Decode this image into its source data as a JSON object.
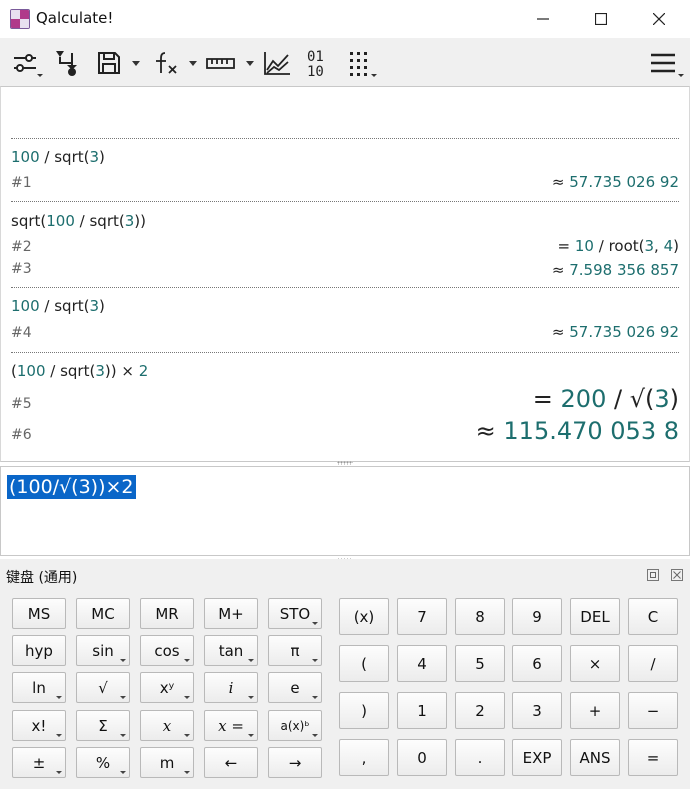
{
  "window": {
    "title": "Qalculate!"
  },
  "history": {
    "entries": [
      {
        "expression_parts": [
          [
            "100",
            "num"
          ],
          [
            " ∕ sqrt(",
            ""
          ],
          [
            "3",
            "num"
          ],
          [
            ")",
            ""
          ]
        ],
        "results": [
          {
            "ref": "#1",
            "prefix": "≈ ",
            "parts": [
              [
                "57.735 026 92",
                "num"
              ]
            ]
          }
        ]
      },
      {
        "expression_parts": [
          [
            "sqrt(",
            ""
          ],
          [
            "100",
            "num"
          ],
          [
            " ∕ sqrt(",
            ""
          ],
          [
            "3",
            "num"
          ],
          [
            "))",
            ""
          ]
        ],
        "results": [
          {
            "ref": "#2",
            "prefix": "= ",
            "parts": [
              [
                "10",
                "num"
              ],
              [
                " ∕ root(",
                ""
              ],
              [
                "3",
                "num"
              ],
              [
                ", ",
                ""
              ],
              [
                "4",
                "num"
              ],
              [
                ")",
                ""
              ]
            ]
          },
          {
            "ref": "#3",
            "prefix": "≈ ",
            "parts": [
              [
                "7.598 356 857",
                "num"
              ]
            ]
          }
        ]
      },
      {
        "expression_parts": [
          [
            "100",
            "num"
          ],
          [
            " ∕ sqrt(",
            ""
          ],
          [
            "3",
            "num"
          ],
          [
            ")",
            ""
          ]
        ],
        "results": [
          {
            "ref": "#4",
            "prefix": "≈ ",
            "parts": [
              [
                "57.735 026 92",
                "num"
              ]
            ]
          }
        ]
      },
      {
        "expression_parts": [
          [
            "(",
            ""
          ],
          [
            "100",
            "num"
          ],
          [
            " ∕ sqrt(",
            ""
          ],
          [
            "3",
            "num"
          ],
          [
            ")) × ",
            ""
          ],
          [
            "2",
            "num"
          ]
        ],
        "results": [
          {
            "ref": "#5",
            "prefix": "= ",
            "parts": [
              [
                "200",
                "num"
              ],
              [
                " ∕ √(",
                ""
              ],
              [
                "3",
                "num"
              ],
              [
                ")",
                ""
              ]
            ]
          },
          {
            "ref": "#6",
            "prefix": "≈ ",
            "parts": [
              [
                "115.470 053 8",
                "num"
              ]
            ]
          }
        ]
      }
    ]
  },
  "entry": {
    "text": "(100/√(3))×2"
  },
  "keypad": {
    "title": "键盘 (通用)",
    "left_rows": [
      [
        {
          "label": "MS",
          "drop": false
        },
        {
          "label": "MC",
          "drop": false
        },
        {
          "label": "MR",
          "drop": false
        },
        {
          "label": "M+",
          "drop": false
        },
        {
          "label": "STO",
          "drop": true
        }
      ],
      [
        {
          "label": "hyp",
          "drop": false
        },
        {
          "label": "sin",
          "drop": true
        },
        {
          "label": "cos",
          "drop": true
        },
        {
          "label": "tan",
          "drop": true
        },
        {
          "label": "π",
          "drop": true
        }
      ],
      [
        {
          "label": "ln",
          "drop": true
        },
        {
          "label": "√",
          "drop": true
        },
        {
          "label": "xʸ",
          "drop": true
        },
        {
          "label": "i",
          "drop": true,
          "italic": true
        },
        {
          "label": "e",
          "drop": true
        }
      ],
      [
        {
          "label": "x!",
          "drop": true
        },
        {
          "label": "Σ",
          "drop": true
        },
        {
          "label": "x",
          "drop": true,
          "italic": true
        },
        {
          "label": "x =",
          "drop": true,
          "italic": true
        },
        {
          "label": "a(x)ᵇ",
          "drop": true,
          "small": true
        }
      ],
      [
        {
          "label": "±",
          "drop": true
        },
        {
          "label": "%",
          "drop": true
        },
        {
          "label": "m",
          "drop": true
        },
        {
          "label": "←",
          "drop": false
        },
        {
          "label": "→",
          "drop": false
        }
      ]
    ],
    "right_rows": [
      [
        "(x)",
        "7",
        "8",
        "9",
        "DEL",
        "C"
      ],
      [
        "(",
        "4",
        "5",
        "6",
        "×",
        "∕"
      ],
      [
        ")",
        "1",
        "2",
        "3",
        "+",
        "−"
      ],
      [
        ",",
        "0",
        ".",
        "EXP",
        "ANS",
        "="
      ]
    ]
  }
}
